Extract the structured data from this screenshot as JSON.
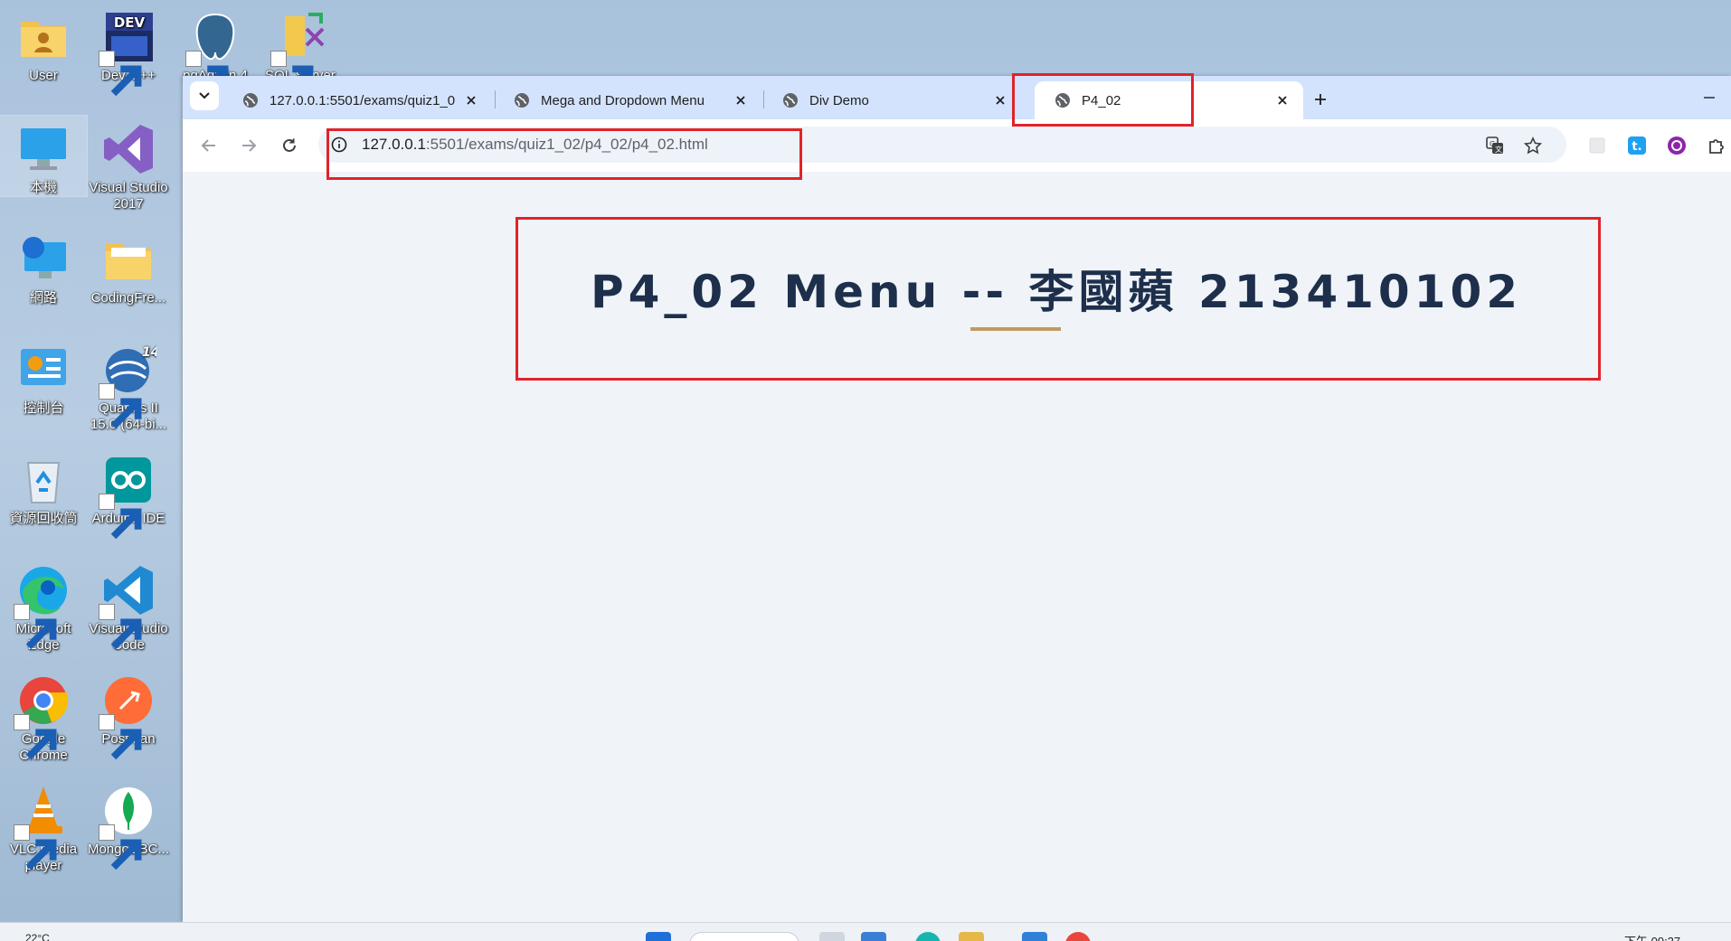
{
  "desktop": {
    "icons": [
      {
        "label": "User",
        "icon": "user-folder-icon"
      },
      {
        "label": "Dev-C++",
        "icon": "devcpp-icon"
      },
      {
        "label": "pgAdmin 4",
        "icon": "pgadmin-icon"
      },
      {
        "label": "SQL Server",
        "icon": "sql-server-icon"
      },
      {
        "label": "本機",
        "icon": "this-pc-icon"
      },
      {
        "label": "Visual Studio 2017",
        "icon": "visual-studio-icon"
      },
      {
        "label": "網路",
        "icon": "network-icon"
      },
      {
        "label": "CodingFre...",
        "icon": "folder-icon"
      },
      {
        "label": "控制台",
        "icon": "control-panel-icon"
      },
      {
        "label": "Quartus II 15.0 (64-bi...",
        "icon": "quartus-icon"
      },
      {
        "label": "資源回收筒",
        "icon": "recycle-bin-icon"
      },
      {
        "label": "Arduino IDE",
        "icon": "arduino-icon"
      },
      {
        "label": "Microsoft Edge",
        "icon": "edge-icon"
      },
      {
        "label": "Visual Studio Code",
        "icon": "vscode-icon"
      },
      {
        "label": "Google Chrome",
        "icon": "chrome-icon"
      },
      {
        "label": "Postman",
        "icon": "postman-icon"
      },
      {
        "label": "VLC media player",
        "icon": "vlc-icon"
      },
      {
        "label": "MongoDBC...",
        "icon": "mongodb-icon"
      }
    ]
  },
  "browser": {
    "tabs": [
      {
        "title": "127.0.0.1:5501/exams/quiz1_0",
        "active": false
      },
      {
        "title": "Mega and Dropdown Menu",
        "active": false
      },
      {
        "title": "Div Demo",
        "active": false
      },
      {
        "title": "P4_02",
        "active": true
      }
    ],
    "address": {
      "host": "127.0.0.1",
      "path": ":5501/exams/quiz1_02/p4_02/p4_02.html"
    }
  },
  "page": {
    "heading": "P4_02 Menu -- 李國蘋 213410102"
  },
  "taskbar": {
    "weather": "22°C",
    "time": "下午 09:27"
  },
  "colors": {
    "tabstrip": "#d3e3fd",
    "page_background": "#f0f4f8",
    "heading_text": "#1d2f4b",
    "heading_underline": "#c29a5b",
    "highlight": "#e0232a"
  }
}
